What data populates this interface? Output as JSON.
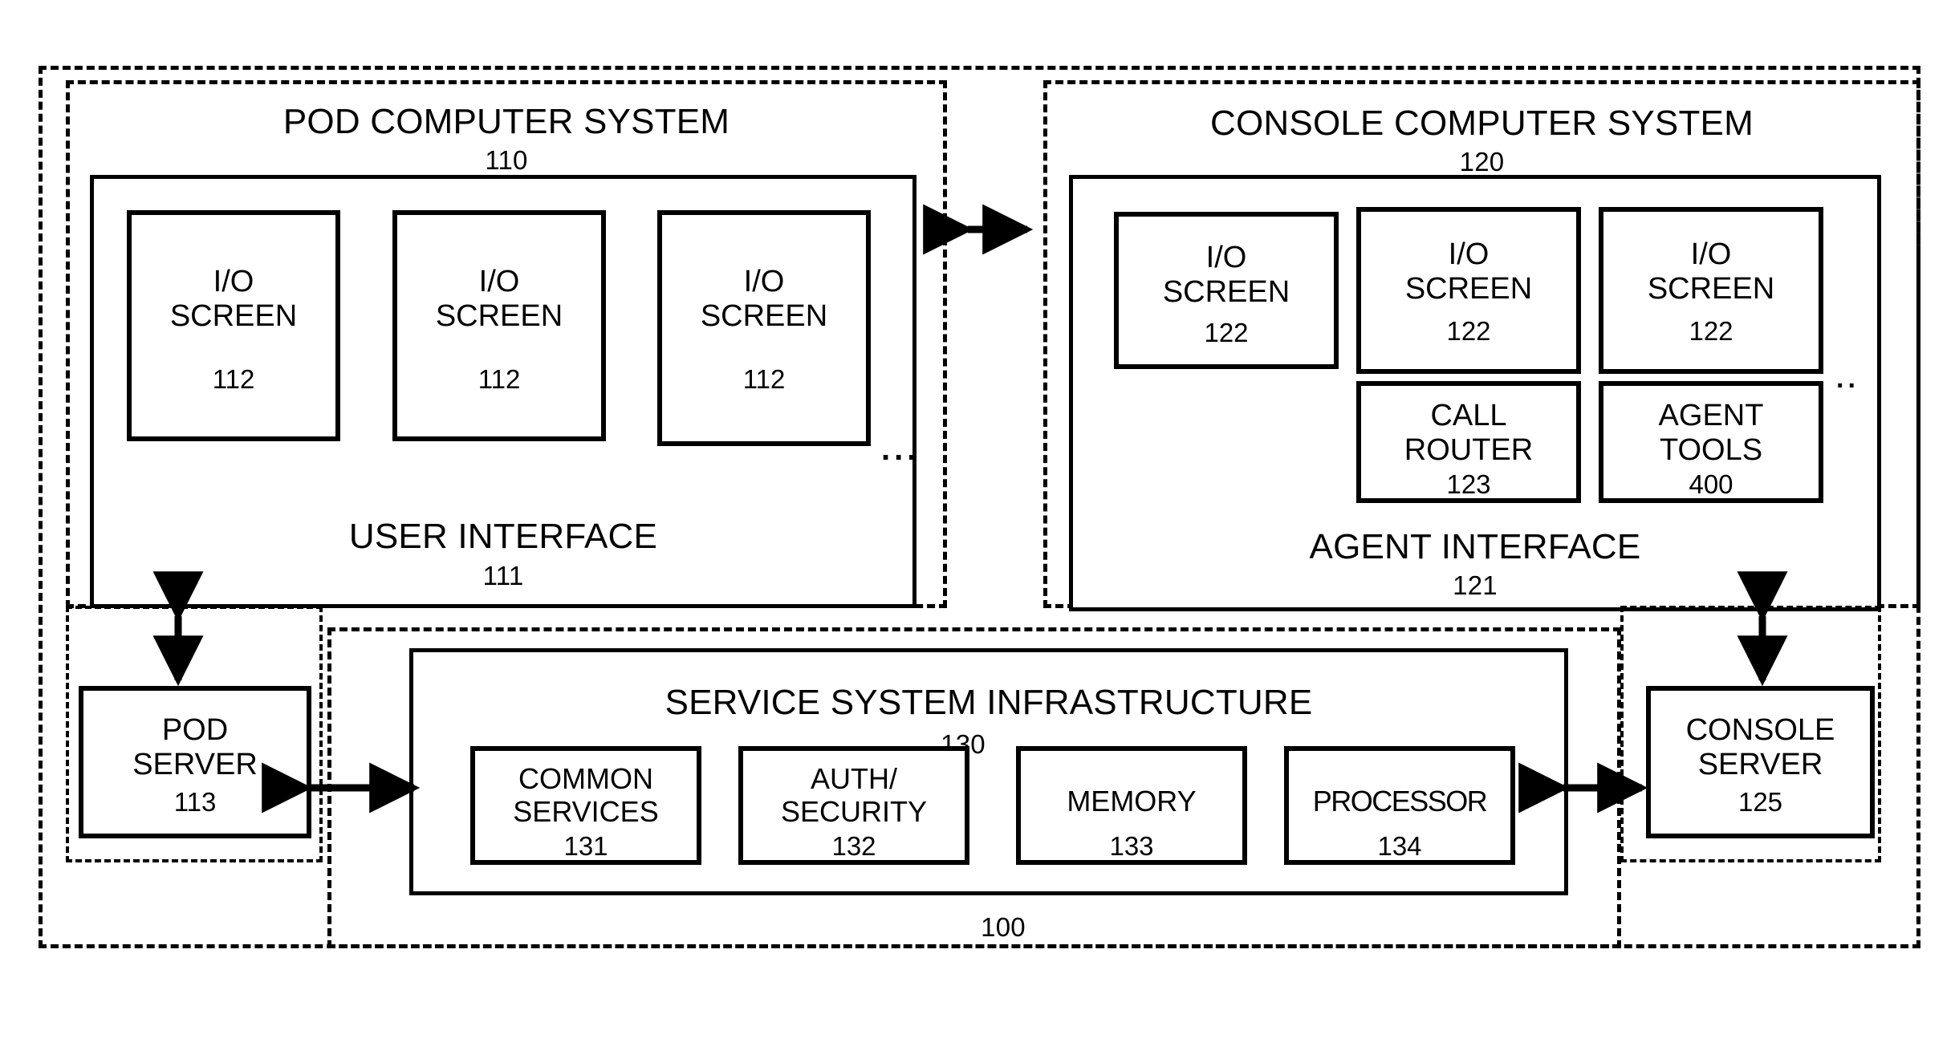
{
  "figure": {
    "overall_ref": "100",
    "pod_system": {
      "title": "POD COMPUTER SYSTEM",
      "ref": "110",
      "user_interface": {
        "title": "USER INTERFACE",
        "ref": "111",
        "screens": [
          {
            "line1": "I/O",
            "line2": "SCREEN",
            "ref": "112"
          },
          {
            "line1": "I/O",
            "line2": "SCREEN",
            "ref": "112"
          },
          {
            "line1": "I/O",
            "line2": "SCREEN",
            "ref": "112"
          }
        ],
        "more_indicator": "..."
      },
      "pod_server": {
        "line1": "POD",
        "line2": "SERVER",
        "ref": "113"
      }
    },
    "console_system": {
      "title": "CONSOLE COMPUTER SYSTEM",
      "ref": "120",
      "agent_interface": {
        "title": "AGENT INTERFACE",
        "ref": "121",
        "screens": [
          {
            "line1": "I/O",
            "line2": "SCREEN",
            "ref": "122"
          },
          {
            "line1": "I/O",
            "line2": "SCREEN",
            "ref": "122"
          },
          {
            "line1": "I/O",
            "line2": "SCREEN",
            "ref": "122"
          }
        ],
        "more_indicator": "..",
        "tools": [
          {
            "line1": "CALL",
            "line2": "ROUTER",
            "ref": "123"
          },
          {
            "line1": "AGENT",
            "line2": "TOOLS",
            "ref": "400"
          }
        ]
      },
      "console_server": {
        "line1": "CONSOLE",
        "line2": "SERVER",
        "ref": "125"
      }
    },
    "service_infrastructure": {
      "title": "SERVICE SYSTEM INFRASTRUCTURE",
      "ref": "130",
      "components": [
        {
          "line1": "COMMON",
          "line2": "SERVICES",
          "ref": "131"
        },
        {
          "line1": "AUTH/",
          "line2": "SECURITY",
          "ref": "132"
        },
        {
          "line1": "MEMORY",
          "line2": "",
          "ref": "133"
        },
        {
          "line1": "PROCESSOR",
          "line2": "",
          "ref": "134"
        }
      ]
    },
    "connectors": [
      {
        "name": "pod-to-console-link",
        "orientation": "horizontal"
      },
      {
        "name": "user-interface-to-pod-server-link",
        "orientation": "vertical"
      },
      {
        "name": "pod-server-to-service-infrastructure-link",
        "orientation": "horizontal"
      },
      {
        "name": "agent-interface-to-console-server-link",
        "orientation": "vertical"
      },
      {
        "name": "service-infrastructure-to-console-server-link",
        "orientation": "horizontal"
      }
    ]
  },
  "colors": {
    "line": "#000000",
    "background": "#ffffff"
  }
}
